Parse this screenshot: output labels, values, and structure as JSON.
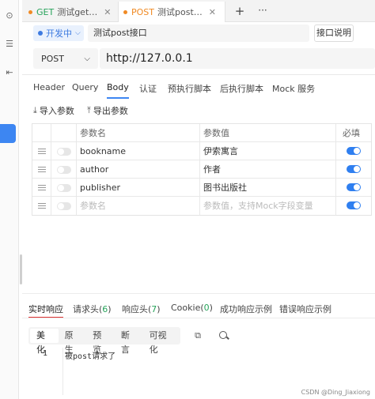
{
  "tabs": [
    {
      "method": "GET",
      "title": "测试get…",
      "close": "✕"
    },
    {
      "method": "POST",
      "title": "测试post…",
      "close": "✕"
    }
  ],
  "tab_actions": {
    "add": "+",
    "more": "···"
  },
  "request": {
    "status": "开发中",
    "name": "测试post接口",
    "doc_button": "接口说明",
    "method": "POST",
    "url": "http://127.0.0.1"
  },
  "req_tabs": [
    "Header",
    "Query",
    "Body",
    "认证",
    "预执行脚本",
    "后执行脚本",
    "Mock 服务"
  ],
  "tools": {
    "import": "导入参数",
    "export": "导出参数"
  },
  "params": {
    "headers": {
      "name": "参数名",
      "value": "参数值",
      "required": "必填"
    },
    "rows": [
      {
        "name": "bookname",
        "value": "伊索寓言",
        "required": true
      },
      {
        "name": "author",
        "value": "作者",
        "required": true
      },
      {
        "name": "publisher",
        "value": "图书出版社",
        "required": true
      }
    ],
    "placeholder": {
      "name": "参数名",
      "value": "参数值，支持Mock字段变量"
    }
  },
  "response": {
    "tabs": {
      "realtime": "实时响应",
      "req_header": "请求头(",
      "req_header_count": "6",
      "res_header": "响应头(",
      "res_header_count": "7",
      "cookie": "Cookie(",
      "cookie_count": "0",
      "close_paren": ")",
      "success_example": "成功响应示例",
      "error_example": "错误响应示例"
    },
    "formats": [
      "美化",
      "原生",
      "预览",
      "断言",
      "可视化"
    ],
    "line_number": "1",
    "body": "被post请求了"
  },
  "watermark": "CSDN @Ding_Jiaxiong",
  "colors": {
    "accent": "#3d86f2",
    "post": "#f08a24",
    "get": "#27a35a"
  }
}
